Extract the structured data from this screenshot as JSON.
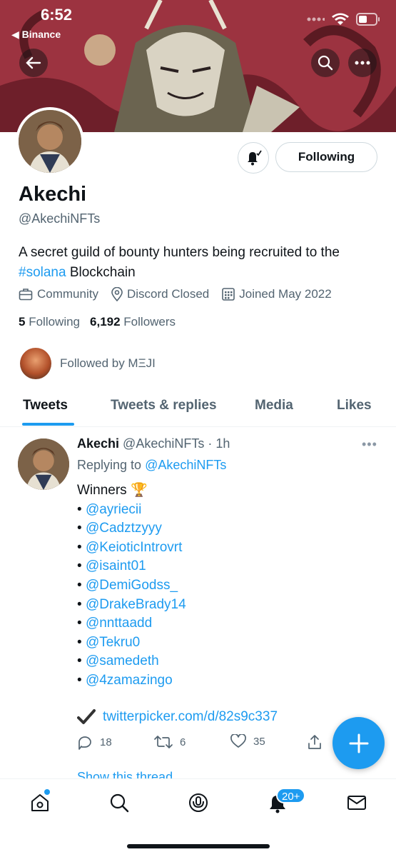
{
  "status_bar": {
    "time": "6:52",
    "back_app": "◀ Binance"
  },
  "profile": {
    "name": "Akechi",
    "handle": "@AkechiNFTs",
    "bio_text": "A secret guild of bounty hunters being recruited to the ",
    "bio_hashtag": "#solana",
    "bio_after": " Blockchain",
    "category": "Community",
    "location": "Discord Closed",
    "joined": "Joined May 2022",
    "following_count": "5",
    "following_label": "Following",
    "followers_count": "6,192",
    "followers_label": "Followers",
    "followed_by": "Followed by MΞJI",
    "follow_button": "Following"
  },
  "tabs": [
    "Tweets",
    "Tweets & replies",
    "Media",
    "Likes"
  ],
  "tweet": {
    "name": "Akechi",
    "meta": "@AkechiNFTs · 1h",
    "replying_prefix": "Replying to ",
    "replying_to": "@AkechiNFTs",
    "first_line": "Winners 🏆",
    "mentions": [
      "@ayriecii",
      "@Cadztzyyy",
      "@KeioticIntrovrt",
      "@isaint01",
      "@DemiGodss_",
      "@DrakeBrady14",
      "@nnttaadd",
      "@Tekru0",
      "@samedeth",
      "@4zamazingo"
    ],
    "link": "twitterpicker.com/d/82s9c337",
    "replies": "18",
    "retweets": "6",
    "likes": "35",
    "show_thread": "Show this thread"
  },
  "bottom_nav": {
    "notifications_badge": "20+"
  },
  "colors": {
    "accent": "#1d9bf0",
    "text": "#0f1419",
    "secondary": "#536471"
  }
}
